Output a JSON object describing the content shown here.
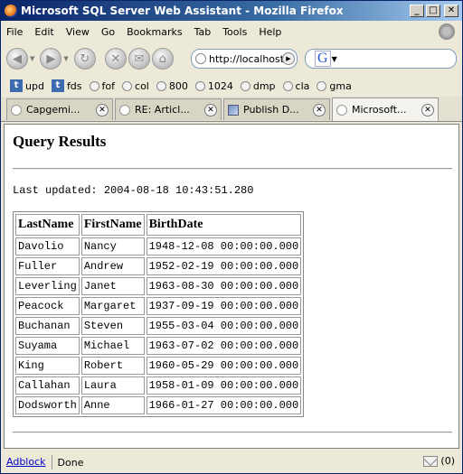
{
  "window": {
    "title": "Microsoft SQL Server Web Assistant - Mozilla Firefox",
    "controls": {
      "minimize": "_",
      "maximize": "□",
      "close": "✕"
    }
  },
  "menubar": {
    "items": [
      {
        "label": "File",
        "icon": ""
      },
      {
        "label": "Edit"
      },
      {
        "label": "View"
      },
      {
        "label": "Go"
      },
      {
        "label": "Bookmarks"
      },
      {
        "label": "Tab"
      },
      {
        "label": "Tools"
      },
      {
        "label": "Help"
      }
    ]
  },
  "navbar": {
    "url": "http://localhost/",
    "search_engine": "G"
  },
  "bookmarks": {
    "items": [
      {
        "label": "upd",
        "icon": "t"
      },
      {
        "label": "fds",
        "icon": "t"
      },
      {
        "label": "fof"
      },
      {
        "label": "col"
      },
      {
        "label": "800"
      },
      {
        "label": "1024"
      },
      {
        "label": "dmp"
      },
      {
        "label": "cla"
      },
      {
        "label": "gma"
      }
    ]
  },
  "tabs": [
    {
      "label": "Capgemi..."
    },
    {
      "label": "RE: Articl..."
    },
    {
      "label": "Publish D..."
    },
    {
      "label": "Microsoft..."
    }
  ],
  "page": {
    "heading": "Query Results",
    "last_updated": "Last updated: 2004-08-18 10:43:51.280",
    "table": {
      "headers": [
        "LastName",
        "FirstName",
        "BirthDate"
      ],
      "rows": [
        [
          "Davolio",
          "Nancy",
          "1948-12-08 00:00:00.000"
        ],
        [
          "Fuller",
          "Andrew",
          "1952-02-19 00:00:00.000"
        ],
        [
          "Leverling",
          "Janet",
          "1963-08-30 00:00:00.000"
        ],
        [
          "Peacock",
          "Margaret",
          "1937-09-19 00:00:00.000"
        ],
        [
          "Buchanan",
          "Steven",
          "1955-03-04 00:00:00.000"
        ],
        [
          "Suyama",
          "Michael",
          "1963-07-02 00:00:00.000"
        ],
        [
          "King",
          "Robert",
          "1960-05-29 00:00:00.000"
        ],
        [
          "Callahan",
          "Laura",
          "1958-01-09 00:00:00.000"
        ],
        [
          "Dodsworth",
          "Anne",
          "1966-01-27 00:00:00.000"
        ]
      ]
    }
  },
  "statusbar": {
    "adblock": "Adblock",
    "status": "Done",
    "mail_count": "(0)"
  }
}
